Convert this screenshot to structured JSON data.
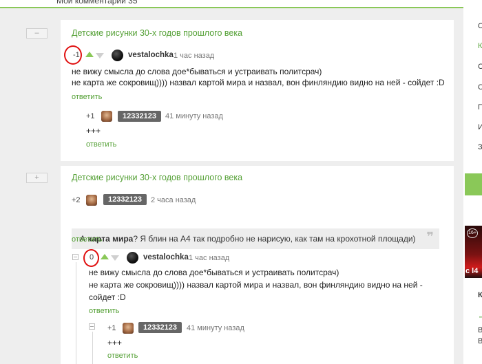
{
  "header": {
    "title": "Мои комментарии 35"
  },
  "sidebar": {
    "menu_letters": [
      "С",
      "К",
      "С",
      "С",
      "П",
      "И",
      "З"
    ],
    "ad_badge": "16+",
    "ad_text": "c l4",
    "extra_letters": [
      "К",
      "\"",
      "В",
      "В"
    ]
  },
  "blocks": [
    {
      "collapse_label": "–",
      "post_title": "Детские рисунки 30-х годов прошлого века",
      "comment": {
        "rating": "-1",
        "author": "vestalochka",
        "time": "1 час назад",
        "lines": [
          "не вижу смысла до слова дое*бываться и устраивать политсрач)",
          "не карта же сокровищ)))) назвал картой мира и назвал, вон финляндию видно на ней - сойдет :D"
        ],
        "reply": "ответить"
      },
      "reply_comment": {
        "rating": "+1",
        "author": "12332123",
        "time": "41 минуту назад",
        "text": "+++",
        "reply": "ответить"
      }
    },
    {
      "collapse_label": "+",
      "post_title": "Детские рисунки 30-х годов прошлого века",
      "parent": {
        "rating": "+2",
        "author": "12332123",
        "time": "2 часа назад",
        "quote_prefix": "А ",
        "quote_bold": "карта мира",
        "quote_rest": "? Я блин на А4 так подробно не нарисую, как там на крохотной площади)",
        "quote_mark": "❞",
        "reply": "ответить"
      },
      "comment": {
        "rating": "0",
        "author": "vestalochka",
        "time": "1 час назад",
        "lines": [
          "не вижу смысла до слова дое*бываться и устраивать политсрач)",
          "не карта же сокровищ)))) назвал картой мира и назвал, вон финляндию видно на ней -",
          "сойдет :D"
        ],
        "reply": "ответить"
      },
      "reply_comment": {
        "rating": "+1",
        "author": "12332123",
        "time": "41 минуту назад",
        "text": "+++",
        "reply": "ответить"
      }
    }
  ],
  "colors": {
    "accent": "#54a035",
    "arrow_up": "#8ac858",
    "highlight": "#e01010",
    "tag_bg": "#666666"
  }
}
